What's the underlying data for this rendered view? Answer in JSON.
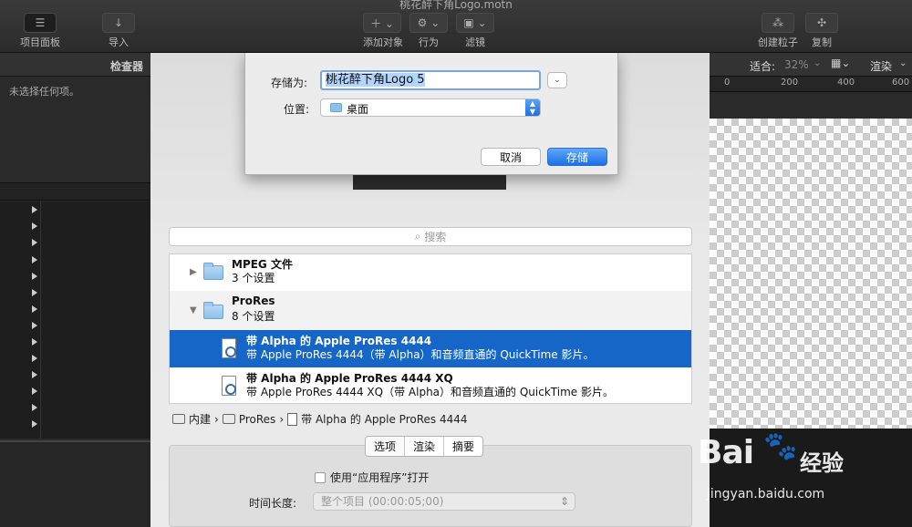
{
  "window": {
    "title": "桃花醉下角Logo.motn"
  },
  "toolbar": {
    "project_panel": "项目面板",
    "import": "导入",
    "add_object": "添加对象",
    "behaviors": "行为",
    "filters": "滤镜",
    "make_particles": "创建粒子",
    "replicate": "复制"
  },
  "inspector": {
    "title": "检查器",
    "empty_text": "未选择任何项。"
  },
  "viewer": {
    "fit_label": "适合:",
    "zoom": "32%",
    "render": "渲染",
    "ruler_ticks": [
      "0",
      "200",
      "400",
      "600"
    ]
  },
  "save_dialog": {
    "save_as_label": "存储为:",
    "filename": "桃花醉下角Logo 5",
    "where_label": "位置:",
    "location": "桌面",
    "cancel": "取消",
    "save": "存储"
  },
  "export": {
    "search_placeholder": "搜索",
    "groups": [
      {
        "title": "MPEG 文件",
        "count": "3 个设置"
      },
      {
        "title": "ProRes",
        "count": "8 个设置"
      }
    ],
    "presets": [
      {
        "title": "带 Alpha 的 Apple ProRes 4444",
        "desc": "带 Apple ProRes 4444（带 Alpha）和音频直通的 QuickTime 影片。"
      },
      {
        "title": "带 Alpha 的 Apple ProRes 4444 XQ",
        "desc": "带 Apple ProRes 4444 XQ（带 Alpha）和音频直通的 QuickTime 影片。"
      }
    ],
    "breadcrumb": [
      "内建",
      "ProRes",
      "带 Alpha 的 Apple ProRes 4444"
    ],
    "tabs": [
      "选项",
      "渲染",
      "摘要"
    ],
    "use_app_checkbox": "使用“应用程序”打开",
    "duration_label": "时间长度:",
    "duration_value": "整个项目 (00:00:05;00)"
  },
  "watermark": {
    "brand": "Bai",
    "brand_cn": "经验",
    "url": "jingyan.baidu.com"
  }
}
